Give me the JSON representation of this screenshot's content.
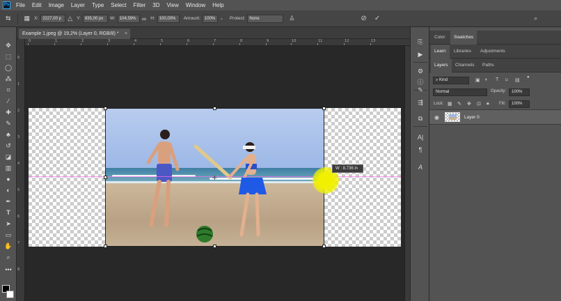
{
  "menu": {
    "logo": "Ps",
    "items": [
      "File",
      "Edit",
      "Image",
      "Layer",
      "Type",
      "Select",
      "Filter",
      "3D",
      "View",
      "Window",
      "Help"
    ]
  },
  "options": {
    "x_label": "X:",
    "x_value": "2227,00 p",
    "y_label": "Y:",
    "y_value": "835,00 px",
    "w_label": "W:",
    "w_value": "104,59%",
    "h_label": "H:",
    "h_value": "100,00%",
    "amount_label": "Amount:",
    "amount_value": "100%",
    "protect_label": "Protect:",
    "protect_value": "None"
  },
  "document": {
    "tab_title": "Example 1.jpeg @ 19,2% (Layer 0, RGB/8) *",
    "close": "×",
    "ruler_top": [
      "0",
      "1",
      "2",
      "3",
      "4",
      "5",
      "6",
      "7",
      "8",
      "9",
      "10",
      "11",
      "12",
      "13"
    ],
    "ruler_left": [
      "0",
      "1",
      "2",
      "3",
      "4",
      "5",
      "6",
      "7",
      "8"
    ]
  },
  "transform_tooltip": "W : 8,736 in",
  "panels": {
    "top_tabs": [
      "Color",
      "Swatches"
    ],
    "mid_tabs": [
      "Learn",
      "Libraries",
      "Adjustments"
    ],
    "layer_tabs": [
      "Layers",
      "Channels",
      "Paths"
    ],
    "kind_placeholder": "Kind",
    "blend_mode": "Normal",
    "opacity_label": "Opacity:",
    "opacity_value": "100%",
    "lock_label": "Lock:",
    "fill_label": "Fill:",
    "fill_value": "100%",
    "layer_name": "Layer 0"
  },
  "colors": {
    "accent": "#31a8ff",
    "guide": "#ff6ee8",
    "cursor_highlight": "#f0f000"
  }
}
